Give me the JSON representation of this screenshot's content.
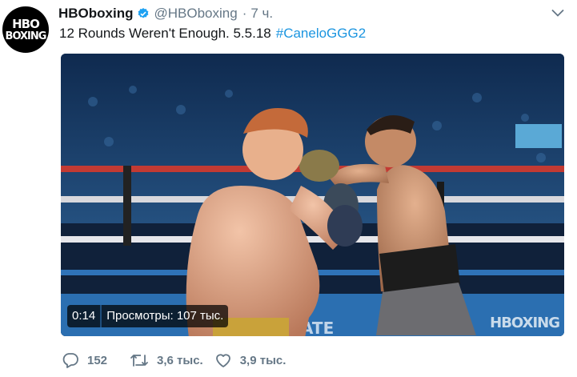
{
  "account": {
    "avatar_line1": "HBO",
    "avatar_line2": "BOXING",
    "display_name": "HBOboxing",
    "handle": "@HBOboxing",
    "separator": "·",
    "time": "7 ч."
  },
  "tweet": {
    "text": "12 Rounds Weren't Enough.  5.5.18",
    "hashtag": "#CaneloGGG2"
  },
  "video": {
    "duration": "0:14",
    "views": "Просмотры: 107 тыс.",
    "watermark": "HBOXING"
  },
  "actions": {
    "replies": "152",
    "retweets": "3,6 тыс.",
    "likes": "3,9 тыс."
  },
  "colors": {
    "link": "#1b95e0",
    "verified": "#1da1f2",
    "muted": "#657786"
  },
  "icons": [
    "verified-badge-icon",
    "chevron-down-icon",
    "reply-icon",
    "retweet-icon",
    "like-icon"
  ]
}
